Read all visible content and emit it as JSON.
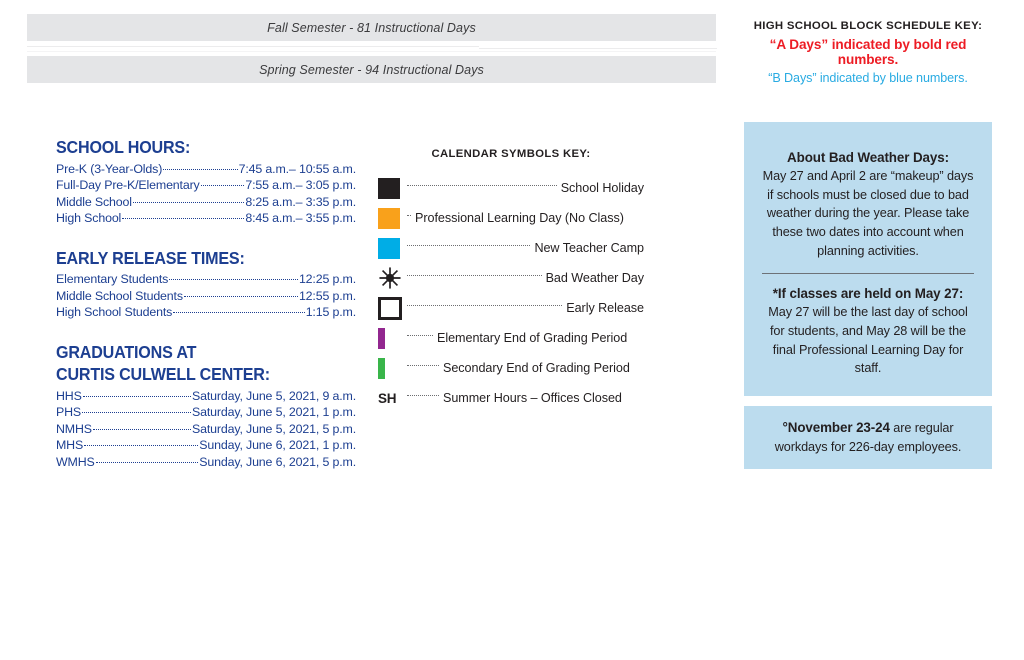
{
  "semesters": [
    {
      "label": "Fall Semester - 81 Instructional Days"
    },
    {
      "label": "Spring Semester - 94 Instructional Days"
    }
  ],
  "school_hours": {
    "heading": "SCHOOL HOURS:",
    "rows": [
      {
        "name": "Pre-K (3-Year-Olds)",
        "value": "7:45 a.m.– 10:55 a.m."
      },
      {
        "name": "Full-Day Pre-K/Elementary",
        "value": "7:55 a.m.– 3:05 p.m."
      },
      {
        "name": "Middle School",
        "value": "8:25 a.m.– 3:35 p.m."
      },
      {
        "name": "High School",
        "value": "8:45 a.m.– 3:55 p.m."
      }
    ]
  },
  "early_release": {
    "heading": "EARLY RELEASE TIMES:",
    "rows": [
      {
        "name": "Elementary Students",
        "value": "12:25 p.m."
      },
      {
        "name": "Middle School Students",
        "value": "12:55 p.m."
      },
      {
        "name": "High School Students",
        "value": "1:15 p.m."
      }
    ]
  },
  "graduations": {
    "heading_line1": "GRADUATIONS AT",
    "heading_line2": "CURTIS CULWELL CENTER:",
    "rows": [
      {
        "name": "HHS",
        "value": "Saturday, June 5, 2021, 9 a.m."
      },
      {
        "name": "PHS",
        "value": "Saturday, June 5, 2021, 1 p.m."
      },
      {
        "name": "NMHS",
        "value": "Saturday, June 5, 2021, 5 p.m."
      },
      {
        "name": "MHS",
        "value": "Sunday, June 6, 2021, 1 p.m."
      },
      {
        "name": "WMHS",
        "value": "Sunday, June 6, 2021, 5 p.m."
      }
    ]
  },
  "symbols_key": {
    "title": "CALENDAR SYMBOLS KEY:",
    "items": [
      {
        "label": "School Holiday",
        "symbol": "filled-square",
        "icon_name": "school-holiday-swatch",
        "color": "#231f20"
      },
      {
        "label": "Professional Learning Day (No Class)",
        "symbol": "filled-square",
        "icon_name": "professional-learning-day-swatch",
        "color": "#f9a11b"
      },
      {
        "label": "New Teacher Camp",
        "symbol": "filled-square",
        "icon_name": "new-teacher-camp-swatch",
        "color": "#00ade6"
      },
      {
        "label": "Bad Weather Day",
        "symbol": "starburst",
        "icon_name": "bad-weather-day-starburst-icon",
        "color": "#231f20"
      },
      {
        "label": "Early Release",
        "symbol": "outline-square",
        "icon_name": "early-release-swatch",
        "color": "#231f20"
      },
      {
        "label": "Elementary End of Grading Period",
        "symbol": "vertical-bar",
        "icon_name": "elementary-grading-period-bar",
        "color": "#92278f"
      },
      {
        "label": "Secondary End of Grading Period",
        "symbol": "vertical-bar",
        "icon_name": "secondary-grading-period-bar",
        "color": "#39b54a"
      },
      {
        "label": "Summer Hours – Offices Closed",
        "symbol": "text",
        "text": "SH",
        "icon_name": "summer-hours-label",
        "color": "#231f20"
      }
    ]
  },
  "block_schedule_key": {
    "title": "HIGH SCHOOL BLOCK SCHEDULE KEY:",
    "a_days": "“A Days” indicated by bold red numbers.",
    "b_days": "“B Days” indicated by blue numbers.",
    "a_color": "#ed1c24",
    "b_color": "#29abe2"
  },
  "bad_weather_panel": {
    "icon_name": "bad-weather-starburst-icon",
    "heading": "About Bad Weather Days:",
    "body": "May 27 and April 2 are “makeup” days if schools must be closed due to bad weather during the year. Please take these two dates into account when planning activities.",
    "second_heading": "*If classes are held on May 27:",
    "second_body": "May 27 will be the last day of school for students, and May 28 will be the final Professional Learning Day for staff.",
    "background": "#bcdcee"
  },
  "note_panel": {
    "bold_lead": "°November 23-24",
    "rest": " are regular workdays for 226-day employees.",
    "background": "#bcdcee"
  }
}
